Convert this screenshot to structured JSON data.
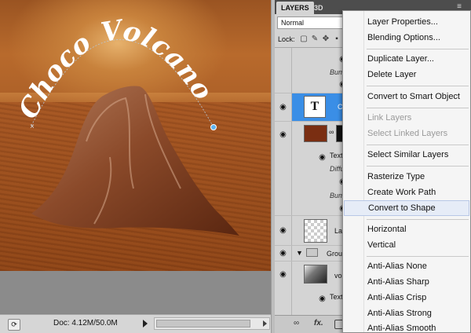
{
  "canvas": {
    "title_text": "Choco Volcano",
    "colors": {
      "sky": "#b86a2c",
      "glow": "#e7b26d",
      "ground": "#8c4316",
      "mountain": "#7a3a1c",
      "text": "#ffffff",
      "path_anchor": "#5fb4f0"
    }
  },
  "statusbar": {
    "doc_info": "Doc: 4.12M/50.0M",
    "zoom_icon": "navigator-icon"
  },
  "panel": {
    "tab_layers": "LAYERS",
    "tab_3d": "3D",
    "panel_menu_icon": "panel-menu-icon",
    "blend_mode": "Normal",
    "lock_label": "Lock:",
    "layers": [
      {
        "fx": "Bum"
      },
      {
        "name": "C",
        "thumb": "T",
        "selected": true
      },
      {
        "effects": [
          "Textu",
          "Diffu",
          "Bum"
        ]
      },
      {
        "name": "Lay"
      },
      {
        "name": "Grou"
      },
      {
        "name": "vo",
        "effects": [
          "Textu"
        ]
      }
    ],
    "bottom_icons": [
      "link-icon",
      "fx-icon",
      "mask-icon"
    ],
    "bottom_fx": "fx."
  },
  "context_menu": {
    "items": [
      {
        "label": "Layer Properties...",
        "enabled": true
      },
      {
        "label": "Blending Options...",
        "enabled": true
      },
      {
        "label": "Duplicate Layer...",
        "enabled": true
      },
      {
        "label": "Delete Layer",
        "enabled": true
      },
      {
        "label": "Convert to Smart Object",
        "enabled": true
      },
      {
        "label": "Link Layers",
        "enabled": false
      },
      {
        "label": "Select Linked Layers",
        "enabled": false
      },
      {
        "label": "Select Similar Layers",
        "enabled": true
      },
      {
        "label": "Rasterize Type",
        "enabled": true
      },
      {
        "label": "Create Work Path",
        "enabled": true
      },
      {
        "label": "Convert to Shape",
        "enabled": true,
        "hovered": true
      },
      {
        "label": "Horizontal",
        "enabled": true
      },
      {
        "label": "Vertical",
        "enabled": true
      },
      {
        "label": "Anti-Alias None",
        "enabled": true
      },
      {
        "label": "Anti-Alias Sharp",
        "enabled": true
      },
      {
        "label": "Anti-Alias Crisp",
        "enabled": true
      },
      {
        "label": "Anti-Alias Strong",
        "enabled": true
      },
      {
        "label": "Anti-Alias Smooth",
        "enabled": true
      }
    ]
  }
}
